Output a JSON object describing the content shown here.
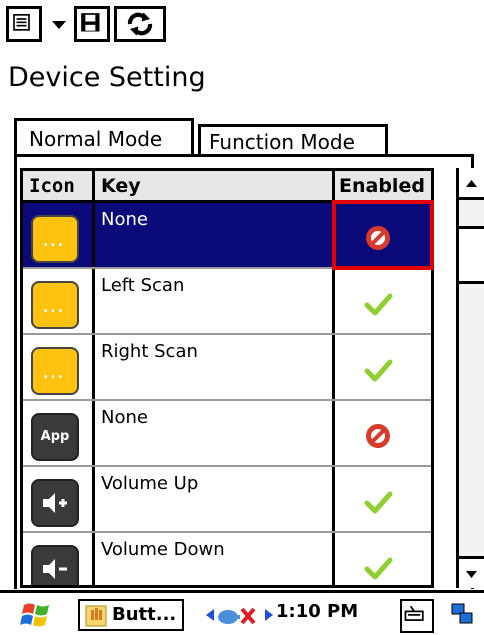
{
  "screen": {
    "title": "Device Setting"
  },
  "tabs": [
    {
      "label": "Normal Mode",
      "active": true
    },
    {
      "label": "Function Mode",
      "active": false
    }
  ],
  "table": {
    "headers": {
      "icon": "Icon",
      "key": "Key",
      "enabled": "Enabled"
    },
    "rows": [
      {
        "icon": "yellow-scan-button-icon",
        "icon_text": "",
        "key": "None",
        "enabled": false,
        "selected": true
      },
      {
        "icon": "yellow-scan-button-icon",
        "icon_text": "",
        "key": "Left Scan",
        "enabled": true,
        "selected": false
      },
      {
        "icon": "yellow-scan-button-icon",
        "icon_text": "",
        "key": "Right Scan",
        "enabled": true,
        "selected": false
      },
      {
        "icon": "app-key-icon",
        "icon_text": "App",
        "key": "None",
        "enabled": false,
        "selected": false
      },
      {
        "icon": "volume-up-key-icon",
        "icon_text": "",
        "key": "Volume Up",
        "enabled": true,
        "selected": false
      },
      {
        "icon": "volume-down-key-icon",
        "icon_text": "",
        "key": "Volume Down",
        "enabled": true,
        "selected": false
      }
    ]
  },
  "taskbar": {
    "start": {
      "icon": "windows-flag-icon"
    },
    "app_task": {
      "label": "Butt..."
    },
    "tray": {
      "network_icon": "network-disconnected-icon",
      "time": "1:10 PM",
      "keyboard_icon": "input-keyboard-icon",
      "switch_icon": "task-switch-icon"
    }
  },
  "colors": {
    "selection": "#0a0a7a",
    "highlight_frame": "#e30000",
    "icon_yellow": "#ffc20e",
    "check": "#8fcf2f",
    "disabled_red": "#d83a2b"
  }
}
